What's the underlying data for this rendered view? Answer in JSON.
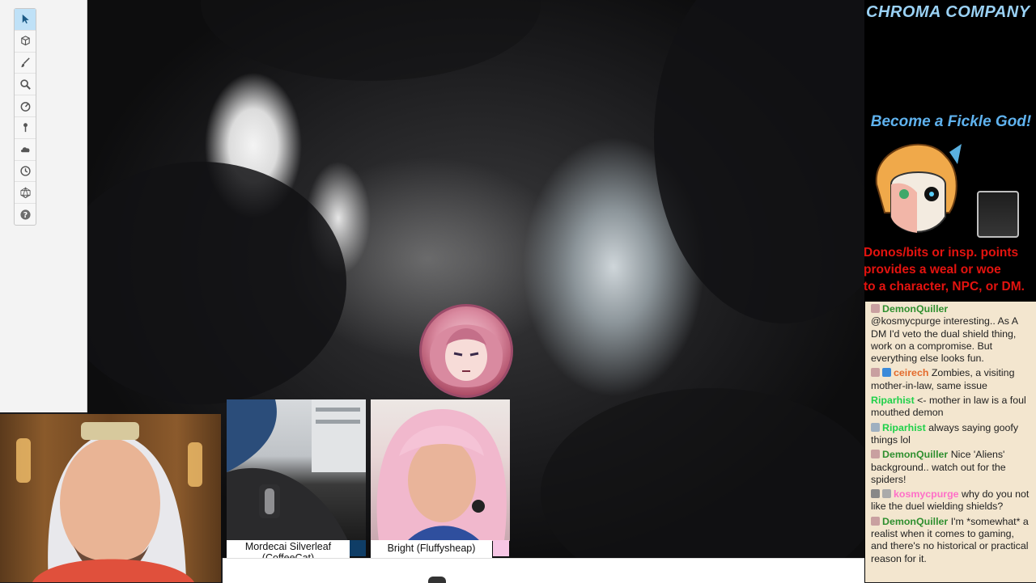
{
  "toolbar": {
    "tools": [
      {
        "icon": "select-arrow-icon",
        "active": true
      },
      {
        "icon": "cube-icon"
      },
      {
        "icon": "brush-icon"
      },
      {
        "icon": "zoom-icon"
      },
      {
        "icon": "measure-icon"
      },
      {
        "icon": "pin-icon"
      },
      {
        "icon": "fog-cloud-icon"
      },
      {
        "icon": "turn-clock-icon"
      },
      {
        "icon": "dice-icon"
      },
      {
        "icon": "help-icon"
      }
    ]
  },
  "webcams": {
    "cam1": {
      "name_line1": "Mordecai Silverleaf",
      "name_line2": "(CoffeeCat)",
      "swatch": "#0f3d66"
    },
    "cam2": {
      "name": "Bright (Fluffysheap)",
      "swatch": "#f7c6e5"
    }
  },
  "stream_overlay": {
    "brand": "CHROMA COMPANY",
    "headline": "Become a Fickle God!",
    "promo_lines": [
      "Donos/bits or insp. points",
      "provides a weal or woe",
      "to a character, NPC, or DM."
    ]
  },
  "chat": {
    "messages": [
      {
        "user": "DemonQuiller",
        "user_color": "#2f8f2f",
        "text": "@kosmycpurge interesting.. As A DM I'd veto the dual shield thing, work on a compromise. But everything else looks fun.",
        "badges": [
          "#c9a0a0"
        ]
      },
      {
        "user": "ceirech",
        "user_color": "#e36a2c",
        "text": "Zombies, a visiting mother-in-law, same issue",
        "badges": [
          "#c9a0a0",
          "#3b8ad9"
        ]
      },
      {
        "user": "Riparhist",
        "user_color": "#1fd14a",
        "text": "<- mother in law is a foul mouthed demon",
        "badges": []
      },
      {
        "user": "Riparhist",
        "user_color": "#1fd14a",
        "text": "always saying goofy things lol",
        "badges": [
          "#9fb0c0"
        ]
      },
      {
        "user": "DemonQuiller",
        "user_color": "#2f8f2f",
        "text": "Nice 'Aliens' background.. watch out for the spiders!",
        "badges": [
          "#c9a0a0"
        ]
      },
      {
        "user": "kosmycpurge",
        "user_color": "#ff6fc8",
        "text": "why do you not like the duel wielding shields?",
        "badges": [
          "#888888",
          "#aaaaaa"
        ]
      },
      {
        "user": "DemonQuiller",
        "user_color": "#2f8f2f",
        "text": "I'm *somewhat* a realist when it comes to gaming, and there's no historical or practical reason for it.",
        "badges": [
          "#c9a0a0"
        ]
      }
    ]
  }
}
